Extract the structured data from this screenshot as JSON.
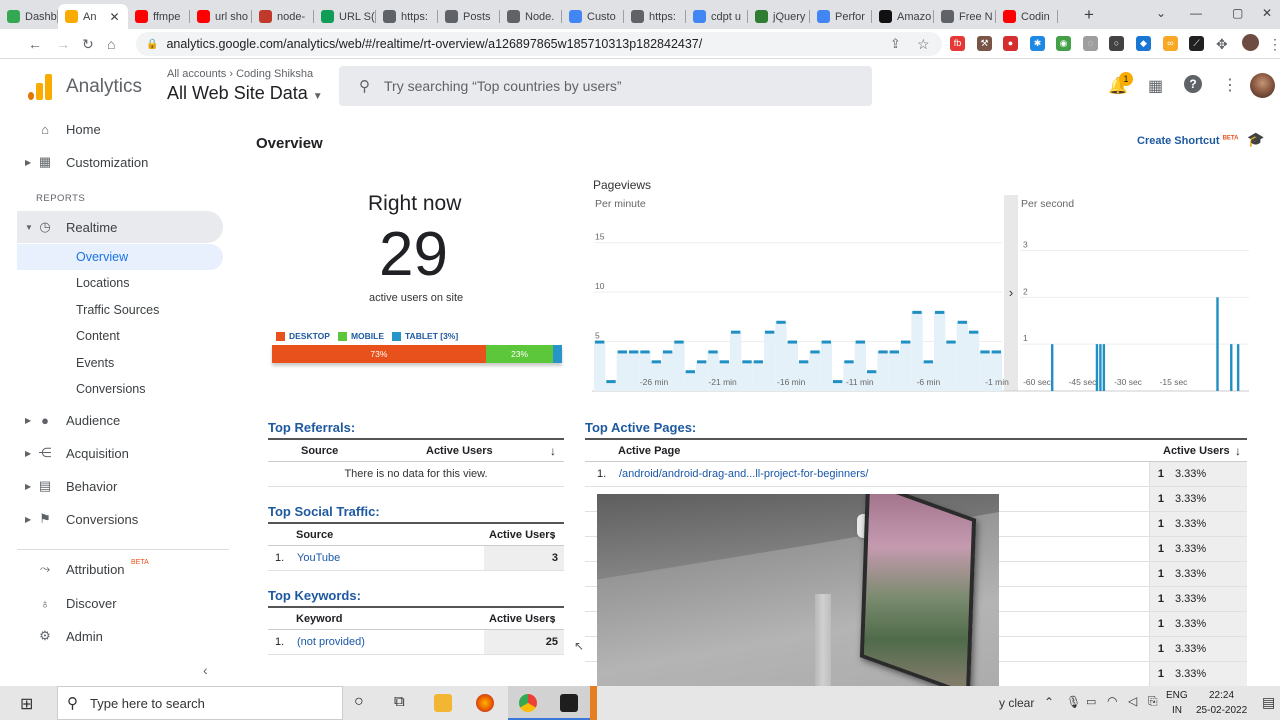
{
  "browser": {
    "tabs": [
      {
        "label": "Dashb",
        "icon": "green-check-icon",
        "color": "#34a853"
      },
      {
        "label": "An",
        "icon": "analytics-icon",
        "color": "#f9ab00",
        "active": true
      },
      {
        "label": "ffmpe",
        "icon": "youtube-icon",
        "color": "#ff0000"
      },
      {
        "label": "url sho",
        "icon": "youtube-icon",
        "color": "#ff0000"
      },
      {
        "label": "node-",
        "icon": "n-icon",
        "color": "#c0392b"
      },
      {
        "label": "URL S(",
        "icon": "sheet-icon",
        "color": "#0f9d58"
      },
      {
        "label": "https:",
        "icon": "globe-icon",
        "color": "#5f6368"
      },
      {
        "label": "Posts",
        "icon": "globe-icon",
        "color": "#5f6368"
      },
      {
        "label": "Node.",
        "icon": "globe-icon",
        "color": "#5f6368"
      },
      {
        "label": "Custo",
        "icon": "google-icon",
        "color": "#4285f4"
      },
      {
        "label": "https:",
        "icon": "globe-icon",
        "color": "#5f6368"
      },
      {
        "label": "cdpt u",
        "icon": "google-icon",
        "color": "#4285f4"
      },
      {
        "label": "jQuery",
        "icon": "w-icon",
        "color": "#2e7d32"
      },
      {
        "label": "Perfor",
        "icon": "perf-icon",
        "color": "#4285f4"
      },
      {
        "label": "Amazo",
        "icon": "amazon-icon",
        "color": "#111111"
      },
      {
        "label": "Free N",
        "icon": "globe-icon",
        "color": "#5f6368"
      },
      {
        "label": "Codin",
        "icon": "youtube-icon",
        "color": "#ff0000"
      }
    ],
    "url": "analytics.google.com/analytics/web/#/realtime/rt-overview/a126897865w185710313p182842437/"
  },
  "header": {
    "breadcrumb_all": "All accounts",
    "breadcrumb_sep": "›",
    "breadcrumb_account": "Coding Shiksha",
    "app_name": "Analytics",
    "property": "All Web Site Data",
    "search_placeholder": "Try searching “Top countries by users”",
    "notification_count": "1"
  },
  "sidebar": {
    "home": "Home",
    "customization": "Customization",
    "reports_label": "REPORTS",
    "realtime": "Realtime",
    "sub": [
      "Overview",
      "Locations",
      "Traffic Sources",
      "Content",
      "Events",
      "Conversions"
    ],
    "audience": "Audience",
    "acquisition": "Acquisition",
    "behavior": "Behavior",
    "conversions": "Conversions",
    "attribution": "Attribution",
    "attribution_badge": "BETA",
    "discover": "Discover",
    "admin": "Admin"
  },
  "main": {
    "title": "Overview",
    "create_shortcut": "Create Shortcut",
    "shortcut_badge": "BETA",
    "right_now": "Right now",
    "active_users": "29",
    "active_users_caption": "active users on site",
    "device_legend": [
      {
        "label": "DESKTOP",
        "color": "#e8501c"
      },
      {
        "label": "MOBILE",
        "color": "#5cc73a"
      },
      {
        "label": "TABLET [3%]",
        "color": "#2795c8"
      }
    ],
    "device_split": {
      "desktop": 73,
      "mobile": 23,
      "tablet": 3
    },
    "device_labels": {
      "desktop": "73%",
      "mobile": "23%"
    },
    "pageviews_title": "Pageviews",
    "per_minute": "Per minute",
    "per_second": "Per second",
    "referrals": {
      "title": "Top Referrals:",
      "col_source": "Source",
      "col_users": "Active Users",
      "empty": "There is no data for this view."
    },
    "social": {
      "title": "Top Social Traffic:",
      "col_source": "Source",
      "col_users": "Active Users",
      "rows": [
        {
          "n": "1.",
          "source": "YouTube",
          "users": "3"
        }
      ]
    },
    "keywords": {
      "title": "Top Keywords:",
      "col_keyword": "Keyword",
      "col_users": "Active Users",
      "rows": [
        {
          "n": "1.",
          "keyword": "(not provided)",
          "users": "25"
        }
      ]
    },
    "pages": {
      "title": "Top Active Pages:",
      "col_page": "Active Page",
      "col_users": "Active Users",
      "rows": [
        {
          "n": "1.",
          "page": "/android/android-drag-and...ll-project-for-beginners/",
          "users": "1",
          "pct": "3.33%"
        },
        {
          "n": "",
          "page": "",
          "users": "1",
          "pct": "3.33%"
        },
        {
          "n": "",
          "page": "",
          "users": "1",
          "pct": "3.33%"
        },
        {
          "n": "",
          "page": "",
          "users": "1",
          "pct": "3.33%"
        },
        {
          "n": "",
          "page": "",
          "users": "1",
          "pct": "3.33%"
        },
        {
          "n": "",
          "page": "",
          "users": "1",
          "pct": "3.33%"
        },
        {
          "n": "",
          "page": "",
          "users": "1",
          "pct": "3.33%"
        },
        {
          "n": "",
          "page": "",
          "users": "1",
          "pct": "3.33%"
        },
        {
          "n": "",
          "page": "",
          "users": "1",
          "pct": "3.33%"
        }
      ]
    }
  },
  "chart_data": [
    {
      "type": "bar",
      "title": "Per minute",
      "ylim": [
        0,
        18
      ],
      "yticks": [
        "5",
        "10",
        "15"
      ],
      "xticks": [
        "-26 min",
        "-21 min",
        "-16 min",
        "-11 min",
        "-6 min",
        "-1 min"
      ],
      "values": [
        5,
        1,
        4,
        4,
        4,
        3,
        4,
        5,
        2,
        3,
        4,
        3,
        6,
        3,
        3,
        6,
        7,
        5,
        3,
        4,
        5,
        1,
        3,
        5,
        2,
        4,
        4,
        5,
        8,
        3,
        8,
        5,
        7,
        6,
        4,
        4
      ]
    },
    {
      "type": "bar",
      "title": "Per second",
      "ylim": [
        0,
        3.8
      ],
      "yticks": [
        "1",
        "2",
        "3"
      ],
      "xticks": [
        "-60 sec",
        "-45 sec",
        "-30 sec",
        "-15 sec"
      ],
      "values": [
        0,
        0,
        0,
        0,
        0,
        0,
        0,
        0,
        0,
        0,
        0,
        0,
        0,
        0,
        0,
        0,
        0,
        0,
        1,
        0,
        0,
        0,
        0,
        0,
        0,
        0,
        0,
        0,
        0,
        0,
        0,
        0,
        0,
        0,
        0,
        0,
        0,
        0,
        0,
        0,
        0,
        0,
        0,
        0,
        1,
        0,
        1,
        0,
        1,
        0,
        0,
        0,
        0,
        0,
        0,
        0,
        0,
        0,
        0,
        0,
        0,
        0,
        0,
        0,
        0,
        0,
        0,
        0,
        0,
        0,
        0,
        0,
        0,
        0,
        0,
        0,
        0,
        0,
        0,
        0,
        0,
        0,
        0,
        0,
        0,
        0,
        0,
        0,
        0,
        0,
        0,
        0,
        0,
        0,
        0,
        0,
        0,
        0,
        0,
        0,
        0,
        0,
        0,
        0,
        0,
        0,
        0,
        0,
        0,
        0,
        0,
        0,
        0,
        0,
        2,
        0,
        0,
        0,
        0,
        0,
        0,
        0,
        1,
        0,
        0,
        0,
        1,
        0,
        0,
        0,
        0,
        0,
        0
      ]
    }
  ],
  "taskbar": {
    "search_placeholder": "Type here to search",
    "clear": "y clear",
    "lang_top": "ENG",
    "lang_bottom": "IN",
    "time": "22:24",
    "date": "25-02-2022"
  }
}
